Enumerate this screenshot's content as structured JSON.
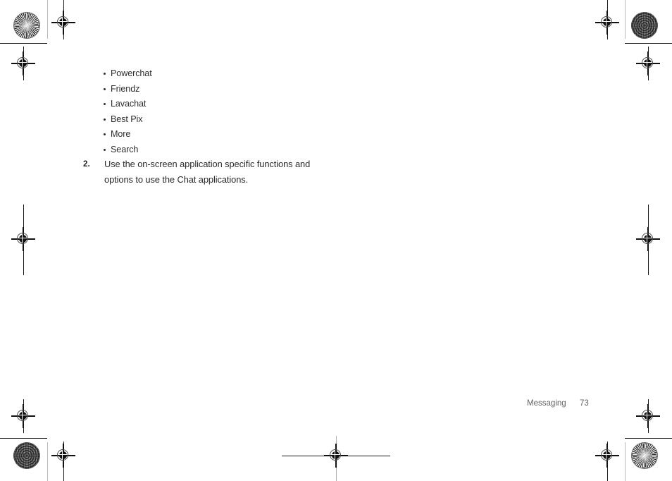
{
  "document": {
    "page_number": "73",
    "section_name": "Messaging"
  },
  "content": {
    "chat_apps": [
      {
        "label": "Powerchat"
      },
      {
        "label": "Friendz"
      },
      {
        "label": "Lavachat"
      },
      {
        "label": "Best Pix"
      },
      {
        "label": "More"
      },
      {
        "label": "Search"
      }
    ],
    "step": {
      "number": "2.",
      "line1": "Use the on-screen application specific functions and",
      "line2": "options to use the Chat applications."
    }
  },
  "print_marks": {
    "registration_icon": "registration-crosshair-icon",
    "star_target_icon": "siemens-star-target-icon",
    "maze_target_icon": "concentric-cross-target-icon",
    "ink_black": "#111111",
    "guide_gray": "#b9b9b9"
  }
}
